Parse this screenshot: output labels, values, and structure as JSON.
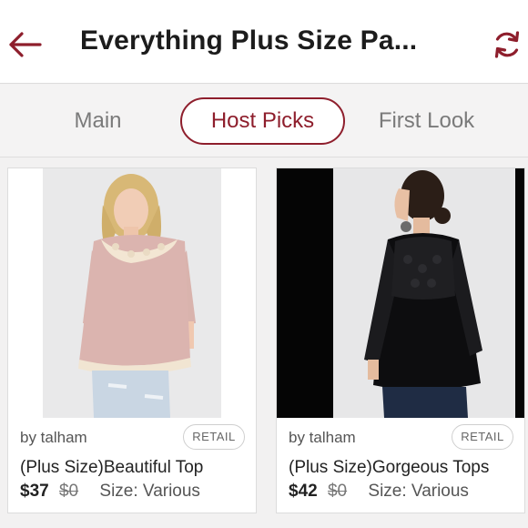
{
  "header": {
    "title": "Everything Plus Size Pa...",
    "back_icon": "back-arrow-icon",
    "refresh_icon": "refresh-icon",
    "accent_color": "#8e1e2c"
  },
  "tabs": [
    {
      "label": "Main",
      "selected": false
    },
    {
      "label": "Host Picks",
      "selected": true
    },
    {
      "label": "First Look",
      "selected": false
    }
  ],
  "listings": [
    {
      "seller": "by talham",
      "badge": "RETAIL",
      "title": "(Plus Size)Beautiful Top",
      "price": "$37",
      "original_price": "$0",
      "size": "Size: Various"
    },
    {
      "seller": "by talham",
      "badge": "RETAIL",
      "title": "(Plus Size)Gorgeous Tops",
      "price": "$42",
      "original_price": "$0",
      "size": "Size: Various"
    }
  ]
}
